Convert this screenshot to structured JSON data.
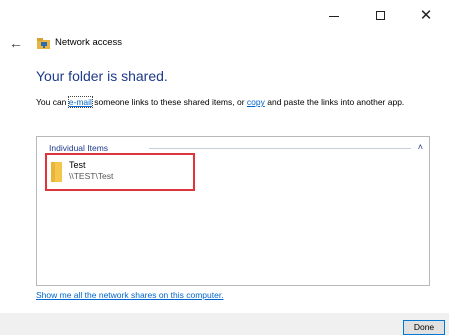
{
  "window": {
    "minimize_glyph": "",
    "close_glyph": "✕"
  },
  "header": {
    "back_glyph": "←",
    "title": "Network access"
  },
  "main": {
    "heading": "Your folder is shared.",
    "desc_part1": "You can ",
    "email_link": "e-mail",
    "desc_part2": " someone links to these shared items, or ",
    "copy_link": "copy",
    "desc_part3": " and paste the links into another app.",
    "group": {
      "header": "Individual Items",
      "chevron": "˄",
      "items": [
        {
          "name": "Test",
          "path": "\\\\TEST\\Test",
          "icon": "folder-icon"
        }
      ]
    },
    "shares_link": "Show me all the network shares on this computer."
  },
  "footer": {
    "done_label": "Done"
  },
  "colors": {
    "heading": "#1e3a8a",
    "link": "#0066cc",
    "highlight": "#e0353b",
    "footer_bg": "#f0f0f0"
  }
}
